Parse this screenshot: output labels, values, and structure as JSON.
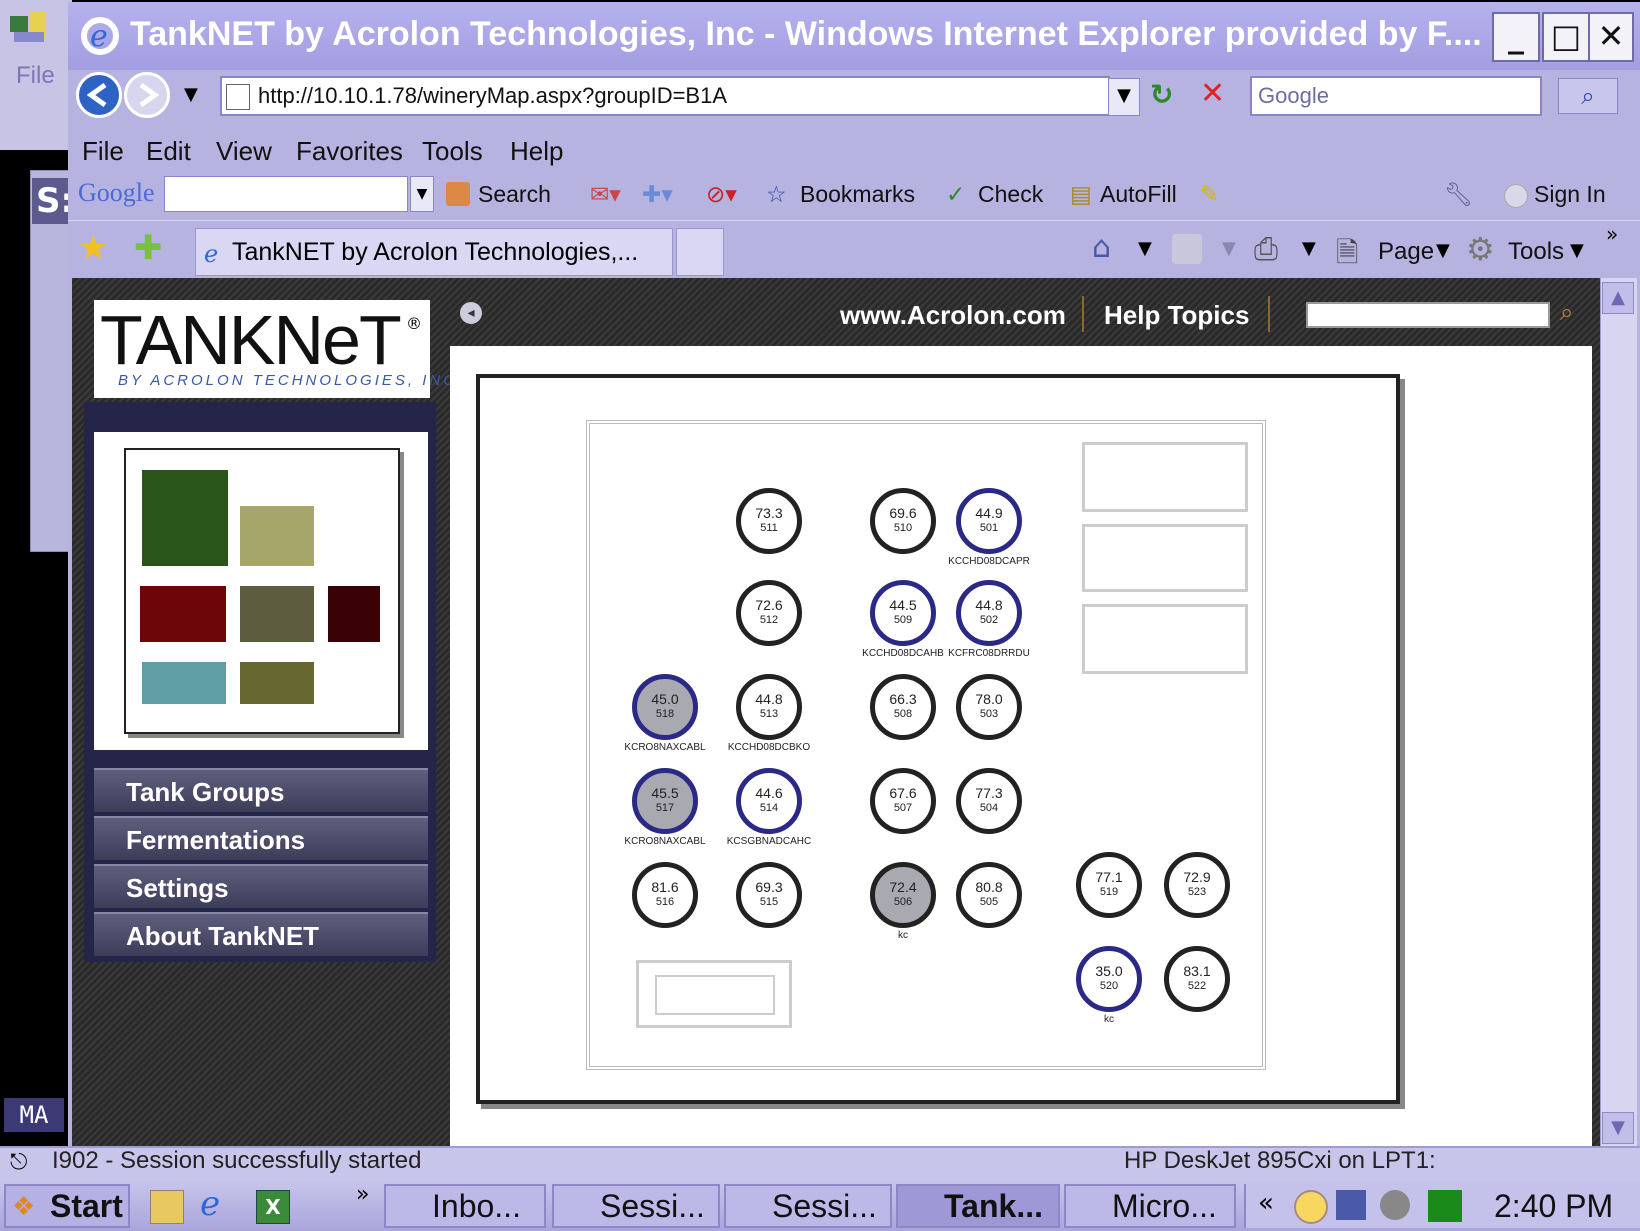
{
  "window": {
    "title": "TankNET by Acrolon Technologies, Inc - Windows Internet Explorer provided by F....",
    "controls": {
      "minimize": "_",
      "maximize": "□",
      "close": "✕"
    }
  },
  "backdrop": {
    "menu_file": "File",
    "s_label": "S:",
    "ma_label": "MA"
  },
  "address_bar": {
    "url": "http://10.10.1.78/wineryMap.aspx?groupID=B1A",
    "search_placeholder": "Google"
  },
  "menu": [
    "File",
    "Edit",
    "View",
    "Favorites",
    "Tools",
    "Help"
  ],
  "google_toolbar": {
    "logo": "Google",
    "search": "Search",
    "bookmarks": "Bookmarks",
    "check": "Check",
    "autofill": "AutoFill",
    "sign_in": "Sign In"
  },
  "tabs": {
    "active_tab": "TankNET by Acrolon Technologies,...",
    "page_menu": "Page",
    "tools_menu": "Tools"
  },
  "site": {
    "logo_main": "TANKNeT",
    "logo_sub": "BY ACROLON TECHNOLOGIES, INC.",
    "link_acrolon": "www.Acrolon.com",
    "link_help": "Help Topics",
    "nav": [
      "Tank Groups",
      "Fermentations",
      "Settings",
      "About TankNET"
    ],
    "swatch_colors": [
      "#2a5518",
      "#a6a56a",
      "#6c0608",
      "#5e5c3e",
      "#3a0204",
      "#5f9ea4",
      "#676730"
    ]
  },
  "tanks": [
    {
      "id": "511",
      "temp": "73.3",
      "label": ""
    },
    {
      "id": "510",
      "temp": "69.6",
      "label": ""
    },
    {
      "id": "501",
      "temp": "44.9",
      "label": "KCCHD08DCAPR"
    },
    {
      "id": "512",
      "temp": "72.6",
      "label": ""
    },
    {
      "id": "509",
      "temp": "44.5",
      "label": "KCCHD08DCAHB"
    },
    {
      "id": "502",
      "temp": "44.8",
      "label": "KCFRC08DRRDU"
    },
    {
      "id": "518",
      "temp": "45.0",
      "label": "KCRO8NAXCABL"
    },
    {
      "id": "513",
      "temp": "44.8",
      "label": "KCCHD08DCBKO"
    },
    {
      "id": "508",
      "temp": "66.3",
      "label": ""
    },
    {
      "id": "503",
      "temp": "78.0",
      "label": ""
    },
    {
      "id": "517",
      "temp": "45.5",
      "label": "KCRO8NAXCABL"
    },
    {
      "id": "514",
      "temp": "44.6",
      "label": "KCSGBNADCAHC"
    },
    {
      "id": "507",
      "temp": "67.6",
      "label": ""
    },
    {
      "id": "504",
      "temp": "77.3",
      "label": ""
    },
    {
      "id": "516",
      "temp": "81.6",
      "label": ""
    },
    {
      "id": "515",
      "temp": "69.3",
      "label": ""
    },
    {
      "id": "506",
      "temp": "72.4",
      "label": "kc"
    },
    {
      "id": "505",
      "temp": "80.8",
      "label": ""
    },
    {
      "id": "519",
      "temp": "77.1",
      "label": ""
    },
    {
      "id": "523",
      "temp": "72.9",
      "label": ""
    },
    {
      "id": "520",
      "temp": "35.0",
      "label": "kc"
    },
    {
      "id": "522",
      "temp": "83.1",
      "label": ""
    }
  ],
  "status_bar": {
    "message": "I902 - Session successfully started",
    "printer": "HP DeskJet 895Cxi on LPT1:"
  },
  "taskbar": {
    "start": "Start",
    "chevron": "»",
    "tasks": [
      "Inbo...",
      "Sessi...",
      "Sessi...",
      "Tank...",
      "Micro..."
    ],
    "tray_chevron": "«",
    "clock": "2:40 PM"
  }
}
